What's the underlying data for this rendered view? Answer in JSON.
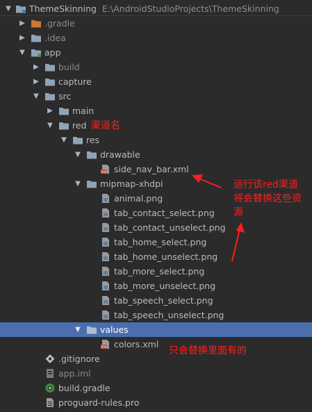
{
  "tree": {
    "root": {
      "name": "ThemeSkinning",
      "path": "E:\\AndroidStudioProjects\\ThemeSkinning"
    },
    "gradle_folder": ".gradle",
    "idea_folder": ".idea",
    "app_module": "app",
    "build_folder": "build",
    "capture_folder": "capture",
    "src_folder": "src",
    "main_folder": "main",
    "red_folder": "red",
    "res_folder": "res",
    "drawable_folder": "drawable",
    "side_nav_bar_file": "side_nav_bar.xml",
    "mipmap_folder": "mipmap-xhdpi",
    "mipmap_files": [
      "animal.png",
      "tab_contact_select.png",
      "tab_contact_unselect.png",
      "tab_home_select.png",
      "tab_home_unselect.png",
      "tab_more_select.png",
      "tab_more_unselect.png",
      "tab_speech_select.png",
      "tab_speech_unselect.png"
    ],
    "values_folder": "values",
    "colors_file": "colors.xml",
    "gitignore_file": ".gitignore",
    "app_iml_file": "app.iml",
    "build_gradle_file": "build.gradle",
    "proguard_file": "proguard-rules.pro"
  },
  "annotations": {
    "channel_name": "渠道名",
    "replace_line1": "运行该red渠道",
    "replace_line2": "将会替换这些资",
    "replace_line3": "源",
    "only_replace": "只会替换里面有的"
  },
  "colors": {
    "background": "#2b2b2b",
    "selection": "#4b6eaf",
    "annotation": "#ff1e1e",
    "folder": "#8fa4b8",
    "excluded_folder": "#cc7832"
  }
}
